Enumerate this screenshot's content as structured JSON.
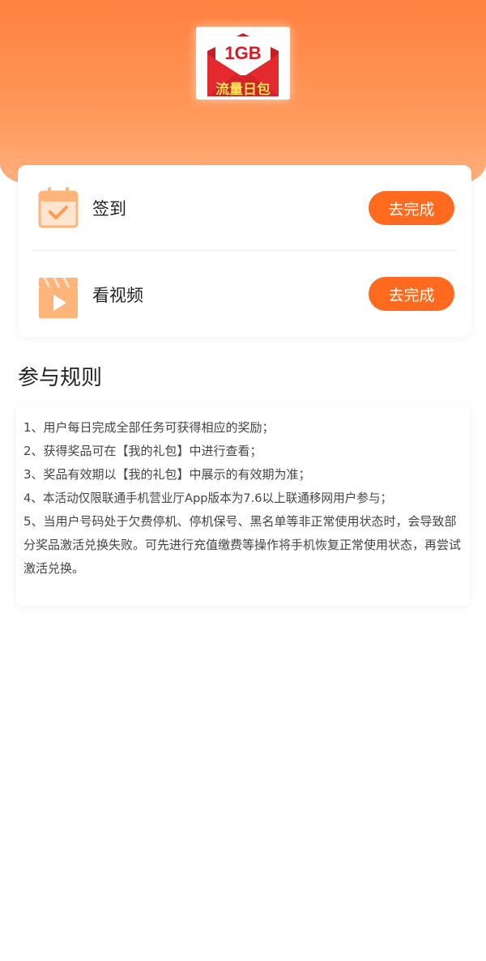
{
  "header": {
    "badge_capacity": "1GB",
    "badge_name": "流量日包",
    "colors": {
      "hero": "#ff8140",
      "envelope": "#e52a2f",
      "badge_text": "#ffe45a"
    }
  },
  "tasks": [
    {
      "label": "签到",
      "icon": "calendar-check-icon",
      "button": "去完成"
    },
    {
      "label": "看视频",
      "icon": "video-play-icon",
      "button": "去完成"
    }
  ],
  "rules": {
    "title": "参与规则",
    "items": [
      "1、用户每日完成全部任务可获得相应的奖励；",
      "2、获得奖品可在【我的礼包】中进行查看；",
      "3、奖品有效期以【我的礼包】中展示的有效期为准；",
      "4、本活动仅限联通手机营业厅App版本为7.6以上联通移网用户参与；",
      "5、当用户号码处于欠费停机、停机保号、黑名单等非正常使用状态时，会导致部分奖品激活兑换失败。可先进行充值缴费等操作将手机恢复正常使用状态，再尝试激活兑换。"
    ]
  },
  "colors": {
    "button": "#ff6a1f",
    "icon": "#ffb47a"
  }
}
